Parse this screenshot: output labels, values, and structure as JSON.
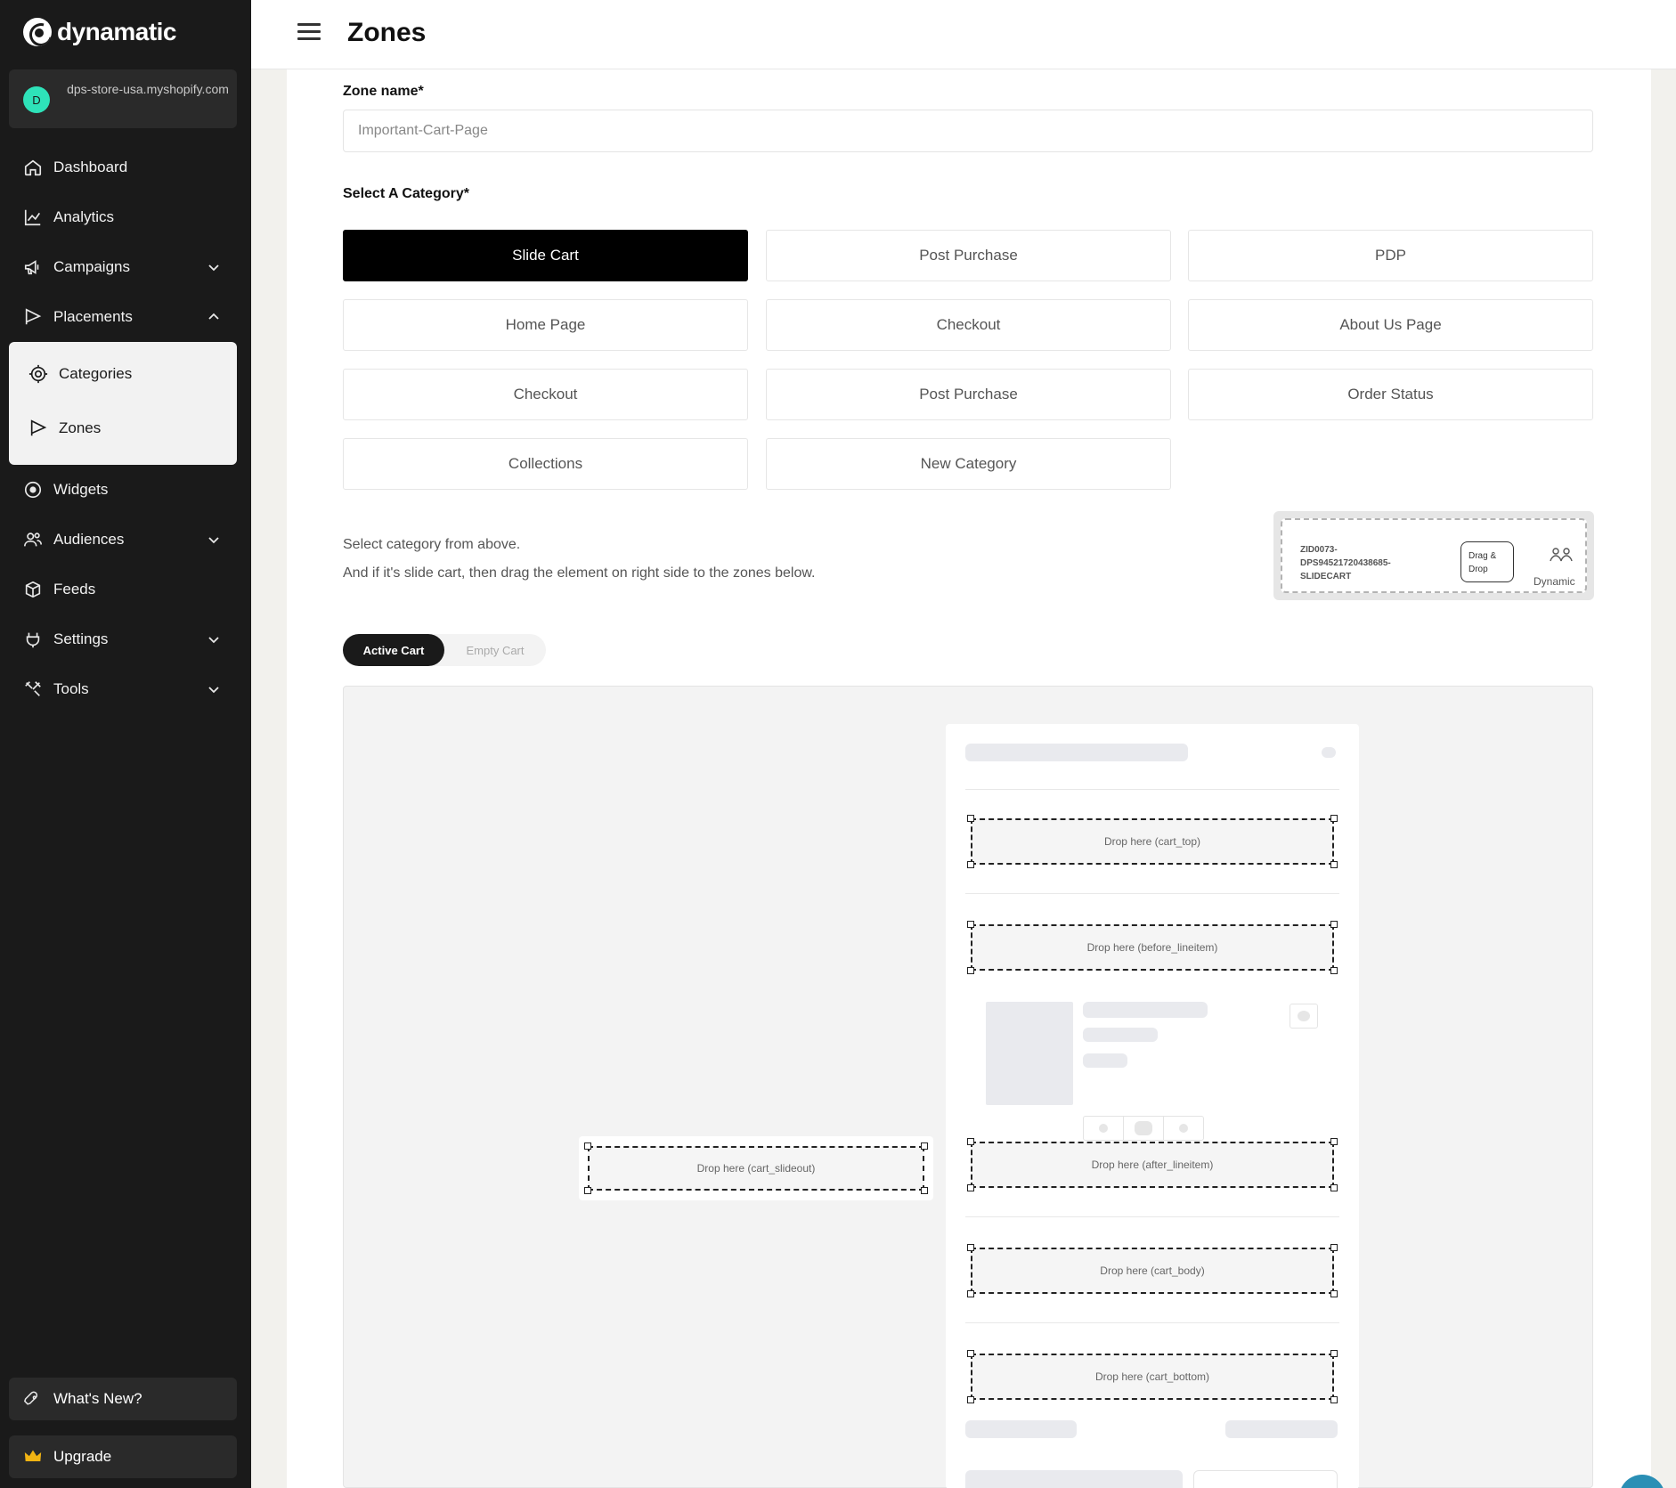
{
  "brand": {
    "name": "dynamatic"
  },
  "store": {
    "avatar": "D",
    "name": "dps-store-usa.myshopify.com"
  },
  "nav": {
    "dashboard": "Dashboard",
    "analytics": "Analytics",
    "campaigns": "Campaigns",
    "placements": "Placements",
    "categories": "Categories",
    "zones": "Zones",
    "widgets": "Widgets",
    "audiences": "Audiences",
    "feeds": "Feeds",
    "settings": "Settings",
    "tools": "Tools"
  },
  "sidebar_bottom": {
    "whats_new": "What's New?",
    "upgrade": "Upgrade"
  },
  "header": {
    "title": "Zones"
  },
  "form": {
    "zone_name_label": "Zone name*",
    "zone_name_value": "Important-Cart-Page",
    "category_label": "Select A Category*",
    "categories": [
      "Slide Cart",
      "Post Purchase",
      "PDP",
      "Home Page",
      "Checkout",
      "About Us Page",
      "Checkout",
      "Post Purchase",
      "Order Status",
      "Collections",
      "New Category"
    ],
    "selected_category": "Slide Cart",
    "hint_line1": "Select category from above.",
    "hint_line2": "And if it's slide cart, then drag the element on right side to the zones below."
  },
  "drag_element": {
    "id": "ZID0073-DPS94521720438685-SLIDECART",
    "pill": "Drag & Drop",
    "label": "Dynamic"
  },
  "cart_toggle": {
    "active": "Active Cart",
    "inactive": "Empty Cart"
  },
  "drop_zones": {
    "cart_top": "Drop here (cart_top)",
    "before_lineitem": "Drop here (before_lineitem)",
    "after_lineitem": "Drop here (after_lineitem)",
    "cart_body": "Drop here (cart_body)",
    "cart_bottom": "Drop here (cart_bottom)",
    "cart_slideout": "Drop here (cart_slideout)"
  },
  "colors": {
    "sidebar_bg": "#1a1a1a",
    "active_category": "#000000",
    "store_avatar": "#2ee2b9"
  }
}
